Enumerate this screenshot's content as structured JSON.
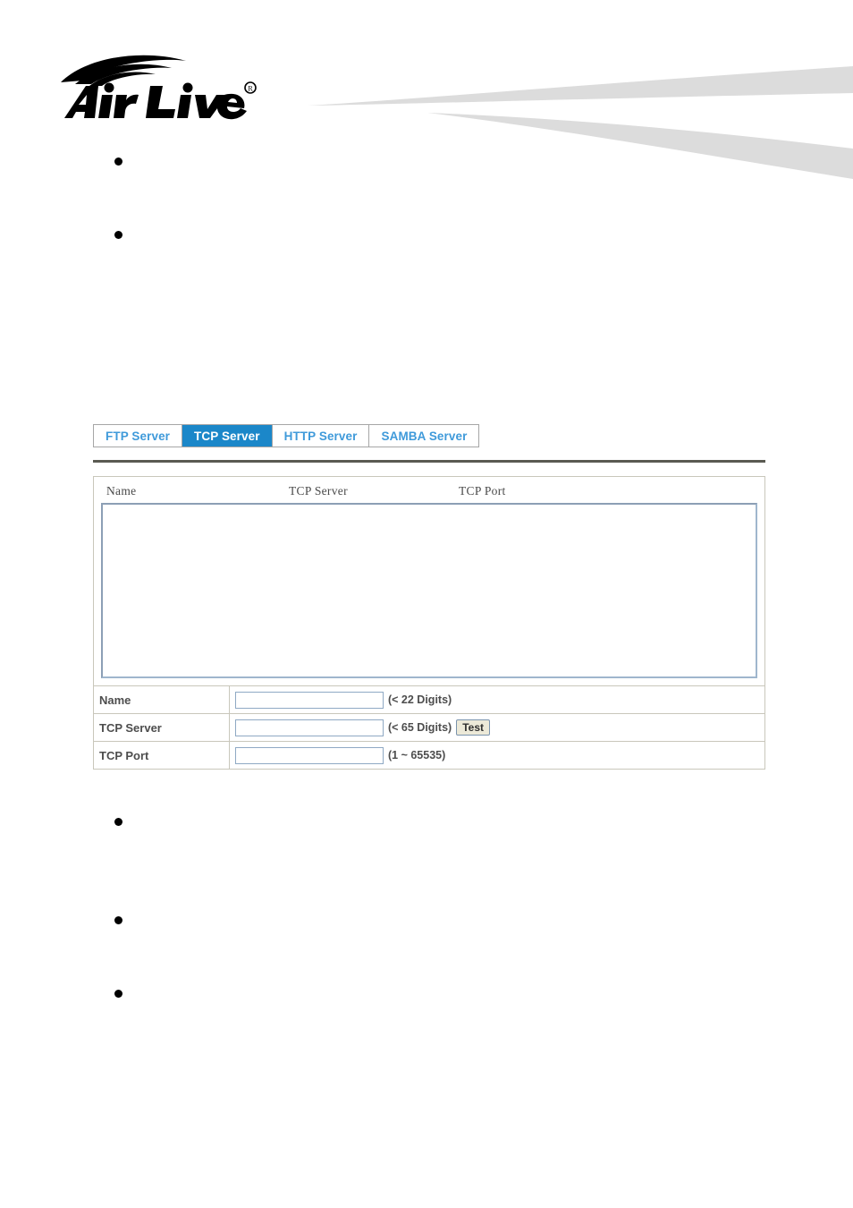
{
  "header": {
    "logo_text": "Air Live",
    "logo_trademark": "®",
    "logo_name": "airlive-logo",
    "swoosh_color": "#dcdcdc"
  },
  "colors": {
    "active_tab_bg": "#1b87c9",
    "active_tab_text": "#ffffff",
    "inactive_tab_text": "#3f9ada",
    "tab_border": "#a6a6a6",
    "panel_border": "#c9c7bb",
    "input_border": "#8fa9c4",
    "listbox_border": "#9fb6cd",
    "rule_color": "#5a5a52",
    "label_text": "#4d4d4d",
    "button_face": "#ece9d8"
  },
  "bullets_top": [
    {
      "name": "bullet-top-1",
      "text": ""
    },
    {
      "name": "bullet-top-2",
      "text": ""
    }
  ],
  "bullets_bottom": [
    {
      "name": "bullet-bottom-1",
      "text": ""
    },
    {
      "name": "bullet-bottom-2",
      "text": ""
    },
    {
      "name": "bullet-bottom-3",
      "text": ""
    }
  ],
  "tabs": [
    {
      "label": "FTP Server",
      "active": false
    },
    {
      "label": "TCP Server",
      "active": true
    },
    {
      "label": "HTTP Server",
      "active": false
    },
    {
      "label": "SAMBA Server",
      "active": false
    }
  ],
  "list_table": {
    "columns": [
      "Name",
      "TCP Server",
      "TCP Port"
    ],
    "rows": []
  },
  "form": {
    "rows": [
      {
        "label": "Name",
        "value": "",
        "placeholder": "",
        "hint": "(< 22 Digits)",
        "has_button": false,
        "button_label": ""
      },
      {
        "label": "TCP Server",
        "value": "",
        "placeholder": "",
        "hint": "(< 65 Digits)",
        "has_button": true,
        "button_label": "Test"
      },
      {
        "label": "TCP Port",
        "value": "",
        "placeholder": "",
        "hint": "(1 ~ 65535)",
        "has_button": false,
        "button_label": ""
      }
    ]
  }
}
